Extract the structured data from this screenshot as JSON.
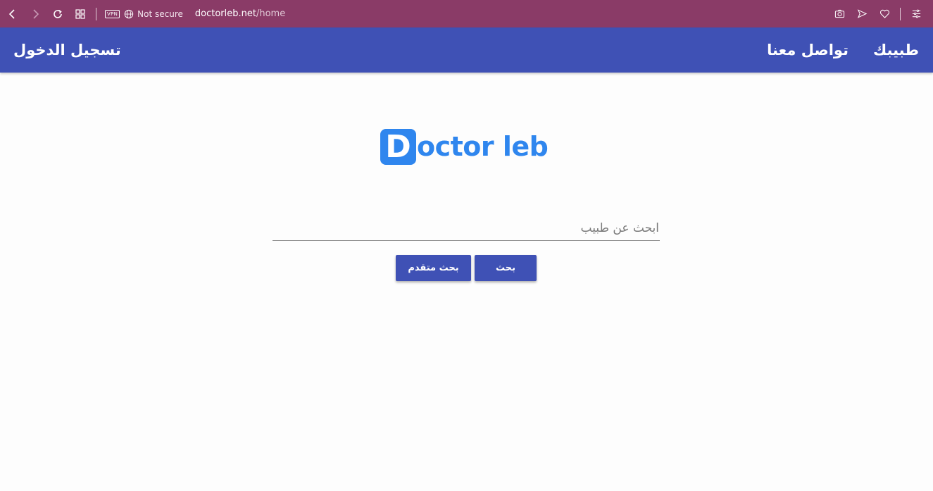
{
  "browser": {
    "vpn_label": "VPN",
    "security_text": "Not secure",
    "url_host": "doctorleb.net",
    "url_path": "/home",
    "icons": [
      "back-icon",
      "forward-icon",
      "reload-icon",
      "tabs-grid-icon",
      "globe-icon",
      "camera-icon",
      "send-icon",
      "heart-icon",
      "menu-icon"
    ]
  },
  "header": {
    "nav_doctor": "طبيبك",
    "nav_contact": "تواصل معنا",
    "nav_login": "تسجيل الدخول",
    "background_color": "#3f51b5"
  },
  "logo": {
    "first_letter": "D",
    "rest": "octor leb",
    "color": "#2f86ee"
  },
  "search": {
    "placeholder": "ابحث عن طبيب",
    "value": ""
  },
  "buttons": {
    "search_label": "بحث",
    "advanced_label": "بحث متقدم"
  }
}
